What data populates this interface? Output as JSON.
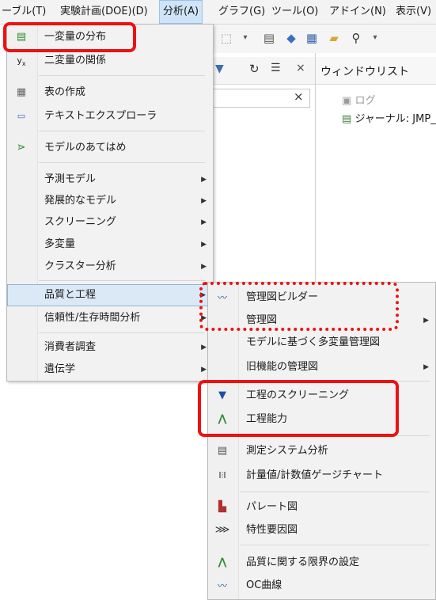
{
  "menubar": {
    "items": [
      "ーブル(T)",
      "実験計画(DOE)(D)",
      "分析(A)",
      "グラフ(G)",
      "ツール(O)",
      "アドイン(N)",
      "表示(V)"
    ]
  },
  "panel": {
    "window_list_title": "ウィンドウリスト",
    "log_label": "ログ",
    "journal_label": "ジャーナル: JMP_"
  },
  "analysis_menu": {
    "items": [
      {
        "label": "一変量の分布",
        "icon": "distribution-icon"
      },
      {
        "label": "二変量の関係",
        "icon": "fit-y-by-x-icon"
      },
      {
        "label": "表の作成",
        "icon": "tabulate-icon"
      },
      {
        "label": "テキストエクスプローラ",
        "icon": "text-explorer-icon"
      },
      {
        "label": "モデルのあてはめ",
        "icon": "fit-model-icon"
      },
      {
        "label": "予測モデル"
      },
      {
        "label": "発展的なモデル"
      },
      {
        "label": "スクリーニング"
      },
      {
        "label": "多変量"
      },
      {
        "label": "クラスター分析"
      },
      {
        "label": "品質と工程"
      },
      {
        "label": "信頼性/生存時間分析"
      },
      {
        "label": "消費者調査"
      },
      {
        "label": "遺伝学"
      }
    ]
  },
  "quality_submenu": {
    "items": [
      {
        "label": "管理図ビルダー",
        "icon": "control-chart-builder-icon"
      },
      {
        "label": "管理図"
      },
      {
        "label": "モデルに基づく多変量管理図"
      },
      {
        "label": "旧機能の管理図"
      },
      {
        "label": "工程のスクリーニング",
        "icon": "process-screening-icon"
      },
      {
        "label": "工程能力",
        "icon": "process-capability-icon"
      },
      {
        "label": "測定システム分析",
        "icon": "measurement-systems-icon"
      },
      {
        "label": "計量値/計数値ゲージチャート",
        "icon": "gauge-chart-icon"
      },
      {
        "label": "パレート図",
        "icon": "pareto-icon"
      },
      {
        "label": "特性要因図",
        "icon": "fishbone-icon"
      },
      {
        "label": "品質に関する限界の設定",
        "icon": "quality-limits-icon"
      },
      {
        "label": "OC曲線",
        "icon": "oc-curve-icon"
      }
    ]
  },
  "colors": {
    "annotation": "#ee1111",
    "highlight": "#dbe9f6",
    "menu_bg": "#f2f2f2"
  }
}
